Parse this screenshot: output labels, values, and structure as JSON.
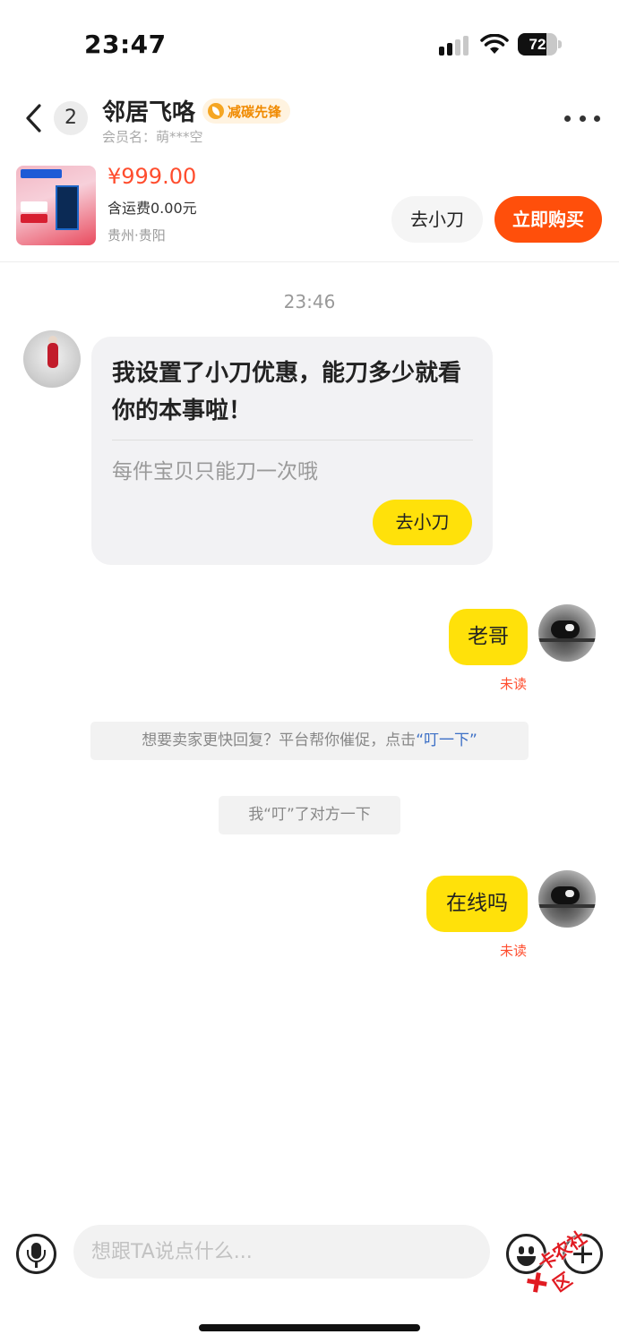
{
  "status_bar": {
    "time": "23:47",
    "battery": "72"
  },
  "header": {
    "unread_count": "2",
    "seller_name": "邻居飞咯",
    "badge": "减碳先锋",
    "member_label": "会员名：",
    "member_name": "萌***空"
  },
  "product": {
    "price": "¥999.00",
    "shipping": "含运费0.00元",
    "location": "贵州·贵阳",
    "cut_button": "去小刀",
    "buy_button": "立即购买"
  },
  "chat": {
    "timestamp": "23:46",
    "seller_card": {
      "title": "我设置了小刀优惠，能刀多少就看你的本事啦！",
      "subtitle": "每件宝贝只能刀一次哦",
      "button": "去小刀"
    },
    "messages": [
      {
        "text": "老哥",
        "status": "未读"
      },
      {
        "text": "在线吗",
        "status": "未读"
      }
    ],
    "system_tip": {
      "text": "想要卖家更快回复？平台帮你催促，点击",
      "link": "“叮一下”"
    },
    "system_nudge": "我“叮”了对方一下"
  },
  "input": {
    "placeholder": "想跟TA说点什么..."
  },
  "watermark": {
    "text": "卡农社区"
  },
  "icons": [
    "back-icon",
    "more-icon",
    "microphone-icon",
    "emoji-icon",
    "plus-icon",
    "signal-icon",
    "wifi-icon",
    "battery-icon"
  ],
  "colors": {
    "accent_yellow": "#ffe10a",
    "buy_orange": "#ff4f0b",
    "price_red": "#ff4d2e",
    "link_blue": "#3c6fc6"
  }
}
